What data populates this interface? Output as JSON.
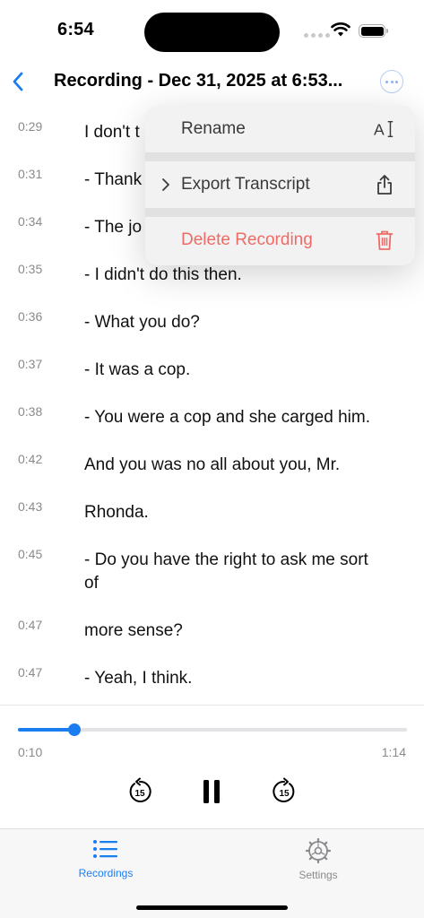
{
  "status_bar": {
    "time": "6:54"
  },
  "nav": {
    "title": "Recording - Dec 31, 2025 at 6:53..."
  },
  "transcript": [
    {
      "time": "0:29",
      "text": "I don't t"
    },
    {
      "time": "0:31",
      "text": "- Thank"
    },
    {
      "time": "0:34",
      "text": "- The jo"
    },
    {
      "time": "0:35",
      "text": "- I didn't do this then."
    },
    {
      "time": "0:36",
      "text": "- What you do?"
    },
    {
      "time": "0:37",
      "text": "- It was a cop."
    },
    {
      "time": "0:38",
      "text": "- You were a cop and she carged him."
    },
    {
      "time": "0:42",
      "text": "And you was no all about you, Mr."
    },
    {
      "time": "0:43",
      "text": "Rhonda."
    },
    {
      "time": "0:45",
      "text": "- Do you have the right to ask me sort of"
    },
    {
      "time": "0:47",
      "text": "more sense?"
    },
    {
      "time": "0:47",
      "text": "- Yeah, I think."
    }
  ],
  "menu": {
    "rename": "Rename",
    "export": "Export Transcript",
    "delete": "Delete Recording"
  },
  "player": {
    "current_time": "0:10",
    "total_time": "1:14",
    "progress": 0.146,
    "skip_seconds": "15"
  },
  "tabs": {
    "recordings": "Recordings",
    "settings": "Settings"
  },
  "colors": {
    "accent": "#1a7ef0",
    "danger": "#ee6b66"
  }
}
